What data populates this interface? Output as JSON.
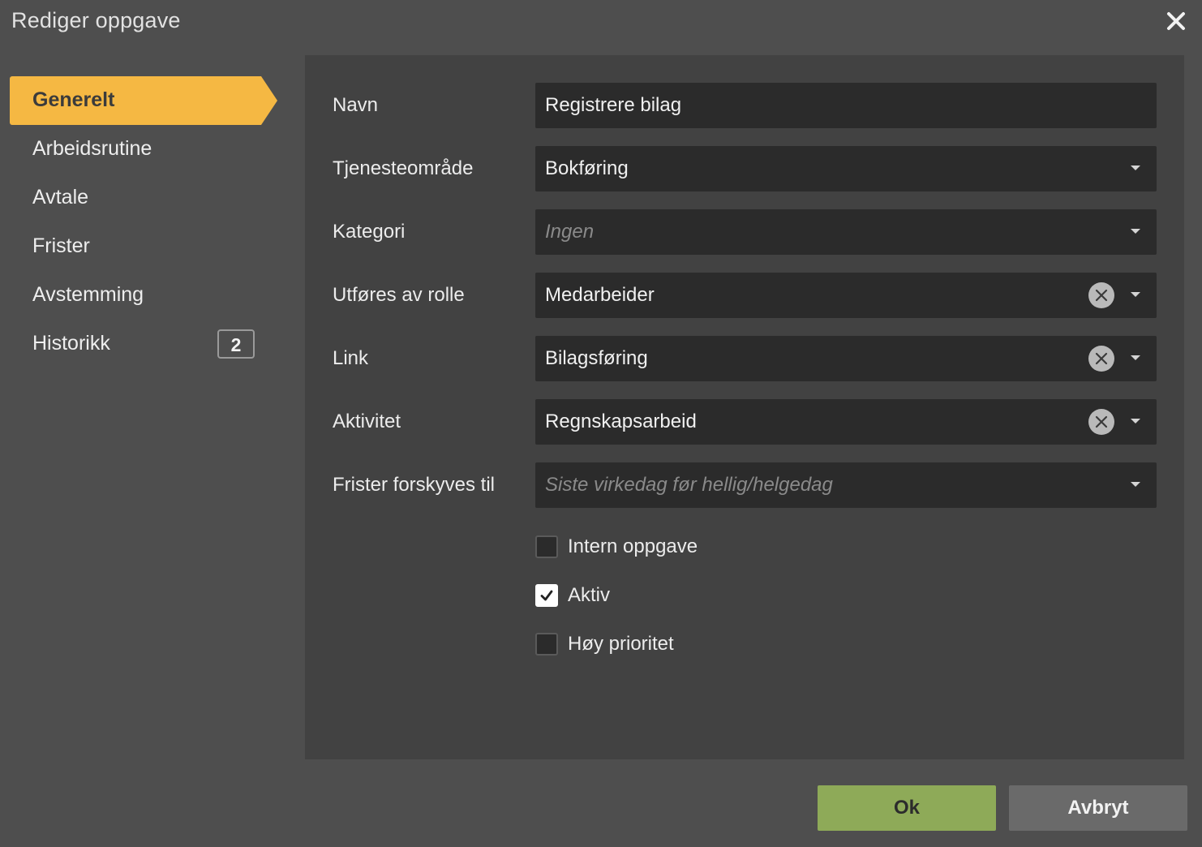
{
  "dialog": {
    "title": "Rediger oppgave"
  },
  "sidebar": {
    "items": [
      {
        "label": "Generelt"
      },
      {
        "label": "Arbeidsrutine"
      },
      {
        "label": "Avtale"
      },
      {
        "label": "Frister"
      },
      {
        "label": "Avstemming"
      },
      {
        "label": "Historikk",
        "badge": "2"
      }
    ],
    "active_index": 0
  },
  "form": {
    "navn": {
      "label": "Navn",
      "value": "Registrere bilag"
    },
    "tjenesteomrade": {
      "label": "Tjenesteområde",
      "value": "Bokføring"
    },
    "kategori": {
      "label": "Kategori",
      "placeholder": "Ingen"
    },
    "rolle": {
      "label": "Utføres av rolle",
      "value": "Medarbeider"
    },
    "link": {
      "label": "Link",
      "value": "Bilagsføring"
    },
    "aktivitet": {
      "label": "Aktivitet",
      "value": "Regnskapsarbeid"
    },
    "frister": {
      "label": "Frister forskyves til",
      "placeholder": "Siste virkedag før hellig/helgedag"
    },
    "checkboxes": [
      {
        "label": "Intern oppgave",
        "checked": false
      },
      {
        "label": "Aktiv",
        "checked": true
      },
      {
        "label": "Høy prioritet",
        "checked": false
      }
    ]
  },
  "footer": {
    "ok_label": "Ok",
    "cancel_label": "Avbryt"
  },
  "colors": {
    "active_tab": "#f5b843",
    "ok_button": "#8eaa58",
    "cancel_button": "#6a6a6a",
    "field_bg": "#2b2b2b",
    "panel_bg": "#424242"
  }
}
